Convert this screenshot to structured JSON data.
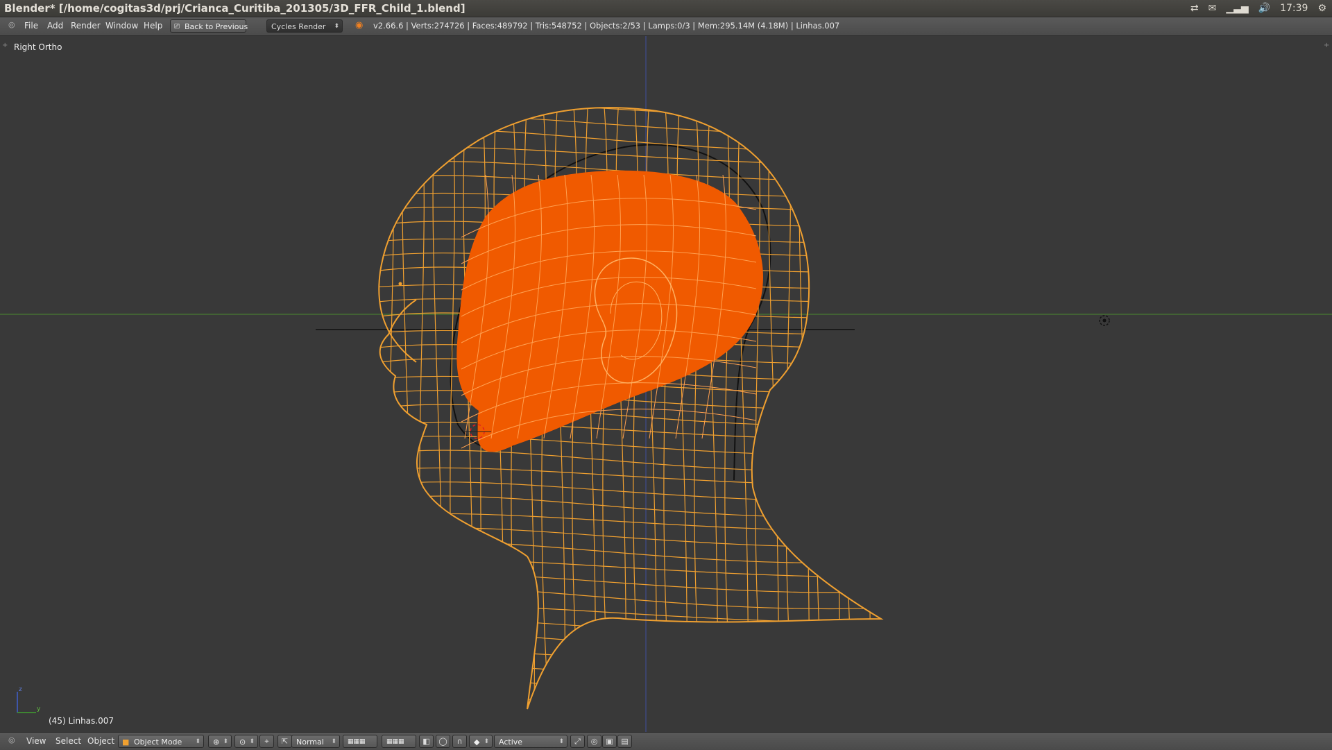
{
  "window": {
    "title": "Blender* [/home/cogitas3d/prj/Crianca_Curitiba_201305/3D_FFR_Child_1.blend]"
  },
  "tray": {
    "clock": "17:39"
  },
  "menu": {
    "items": [
      "File",
      "Add",
      "Render",
      "Window",
      "Help"
    ]
  },
  "toolbar": {
    "back_label": "Back to Previous",
    "engine": "Cycles Render",
    "stats": "v2.66.6 | Verts:274726 | Faces:489792 | Tris:548752 | Objects:2/53 | Lamps:0/3 | Mem:295.14M (4.18M) | Linhas.007"
  },
  "viewport": {
    "view_label": "Right Ortho",
    "object_label": "(45) Linhas.007",
    "axis_z": "z",
    "axis_y": "y"
  },
  "bottom": {
    "menus": [
      "View",
      "Select",
      "Object"
    ],
    "mode": "Object Mode",
    "orientation": "Normal",
    "snap_target": "Active"
  },
  "colors": {
    "background": "#393939",
    "wire": "#f0a030",
    "solid": "#f05a00",
    "green_axis": "#4a8a30",
    "blue_axis": "#4050a0"
  }
}
